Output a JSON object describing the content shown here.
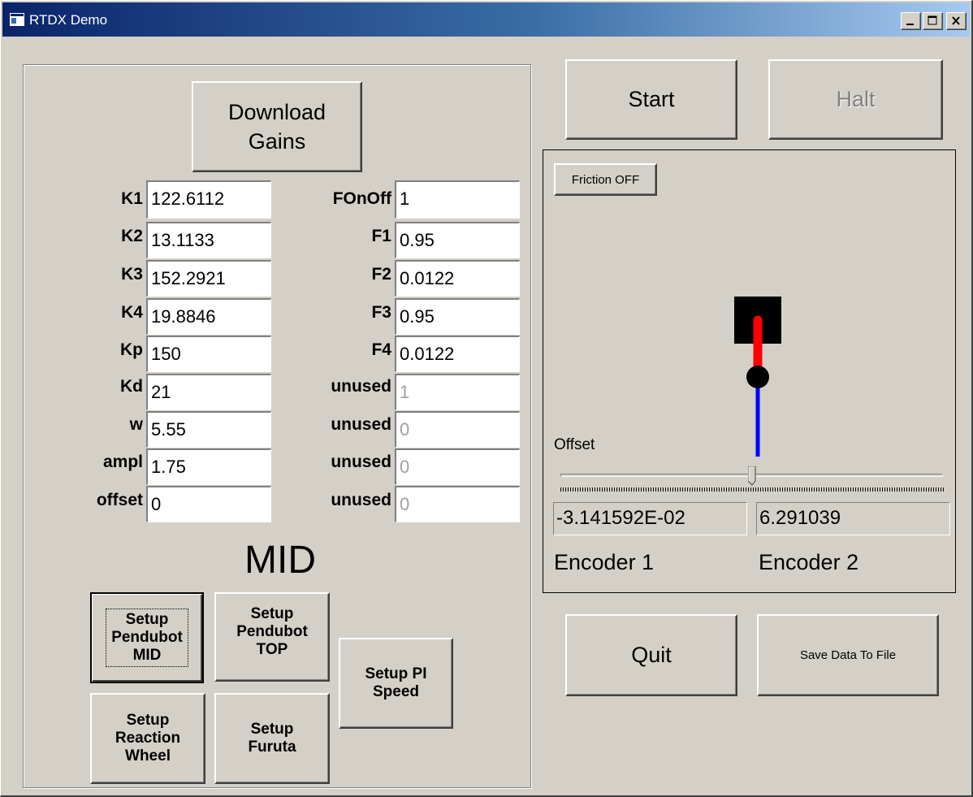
{
  "window": {
    "title": "RTDX Demo",
    "minimize_glyph": "_",
    "maximize_glyph": "□",
    "close_glyph": "×"
  },
  "gains": {
    "download_label_line1": "Download",
    "download_label_line2": "Gains",
    "left": [
      {
        "label": "K1",
        "value": "122.6112"
      },
      {
        "label": "K2",
        "value": "13.1133"
      },
      {
        "label": "K3",
        "value": "152.2921"
      },
      {
        "label": "K4",
        "value": "19.8846"
      },
      {
        "label": "Kp",
        "value": "150"
      },
      {
        "label": "Kd",
        "value": "21"
      },
      {
        "label": "w",
        "value": "5.55"
      },
      {
        "label": "ampl",
        "value": "1.75"
      },
      {
        "label": "offset",
        "value": "0"
      }
    ],
    "right": [
      {
        "label": "FOnOff",
        "value": "1"
      },
      {
        "label": "F1",
        "value": "0.95"
      },
      {
        "label": "F2",
        "value": "0.0122"
      },
      {
        "label": "F3",
        "value": "0.95"
      },
      {
        "label": "F4",
        "value": "0.0122"
      },
      {
        "label": "unused",
        "value": "1"
      },
      {
        "label": "unused",
        "value": "0"
      },
      {
        "label": "unused",
        "value": "0"
      },
      {
        "label": "unused",
        "value": "0"
      }
    ],
    "mode_label": "MID"
  },
  "setup_buttons": {
    "pendubot_mid": [
      "Setup",
      "Pendubot",
      "MID"
    ],
    "pendubot_top": [
      "Setup",
      "Pendubot",
      "TOP"
    ],
    "pi_speed": [
      "Setup PI",
      "Speed"
    ],
    "reaction_wheel": [
      "Setup",
      "Reaction",
      "Wheel"
    ],
    "furuta": [
      "Setup",
      "Furuta"
    ]
  },
  "controls": {
    "start_label": "Start",
    "halt_label": "Halt",
    "quit_label": "Quit",
    "save_label": "Save Data To File"
  },
  "display": {
    "friction_label": "Friction OFF",
    "offset_label": "Offset",
    "offset_slider_fraction": 0.5,
    "encoder1_value": "-3.141592E-02",
    "encoder2_value": "6.291039",
    "encoder1_label": "Encoder 1",
    "encoder2_label": "Encoder 2"
  },
  "colors": {
    "link1": "#ff0000",
    "link2": "#0000ff",
    "base": "#000000"
  }
}
